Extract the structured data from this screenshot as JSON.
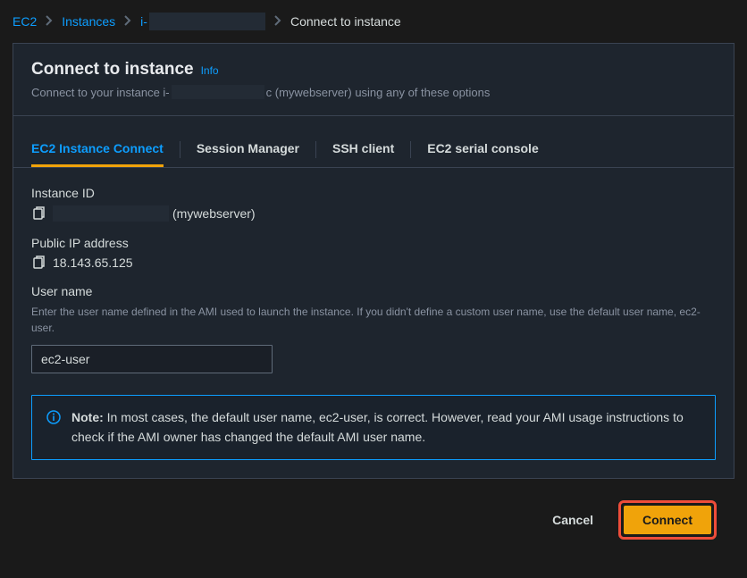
{
  "breadcrumbs": {
    "ec2": "EC2",
    "instances": "Instances",
    "instance_prefix": "i-",
    "current": "Connect to instance"
  },
  "header": {
    "title": "Connect to instance",
    "info": "Info",
    "subtitle_prefix": "Connect to your instance i-",
    "subtitle_suffix": "c (mywebserver) using any of these options"
  },
  "tabs": {
    "ec2_connect": "EC2 Instance Connect",
    "session_manager": "Session Manager",
    "ssh_client": "SSH client",
    "serial_console": "EC2 serial console"
  },
  "fields": {
    "instance_id_label": "Instance ID",
    "instance_id_suffix": "(mywebserver)",
    "public_ip_label": "Public IP address",
    "public_ip_value": "18.143.65.125",
    "username_label": "User name",
    "username_help": "Enter the user name defined in the AMI used to launch the instance. If you didn't define a custom user name, use the default user name, ec2-user.",
    "username_value": "ec2-user"
  },
  "note": {
    "label": "Note:",
    "text": " In most cases, the default user name, ec2-user, is correct. However, read your AMI usage instructions to check if the AMI owner has changed the default AMI user name."
  },
  "footer": {
    "cancel": "Cancel",
    "connect": "Connect"
  }
}
